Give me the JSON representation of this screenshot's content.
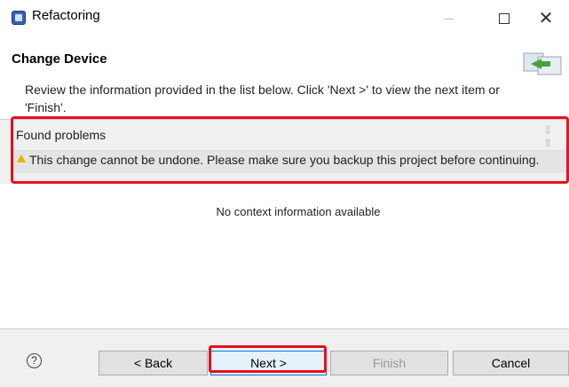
{
  "window": {
    "title": "Refactoring",
    "min_icon": "minimize-icon",
    "max_icon": "maximize-icon",
    "close_icon": "close-icon"
  },
  "header": {
    "page_title": "Change Device",
    "description": "Review the information provided in the list below. Click 'Next >' to view the next item or 'Finish'."
  },
  "problems": {
    "label": "Found problems",
    "nav_icons": "⇩ ⇧",
    "warning_text": "This change cannot be undone. Please make sure you backup this project before continuing."
  },
  "content": {
    "empty_text": "No context information available"
  },
  "buttons": {
    "help": "?",
    "back": "< Back",
    "next": "Next >",
    "finish": "Finish",
    "cancel": "Cancel"
  },
  "colors": {
    "highlight": "#e8101e",
    "warning": "#e8b400",
    "primary_border": "#0078d7"
  }
}
